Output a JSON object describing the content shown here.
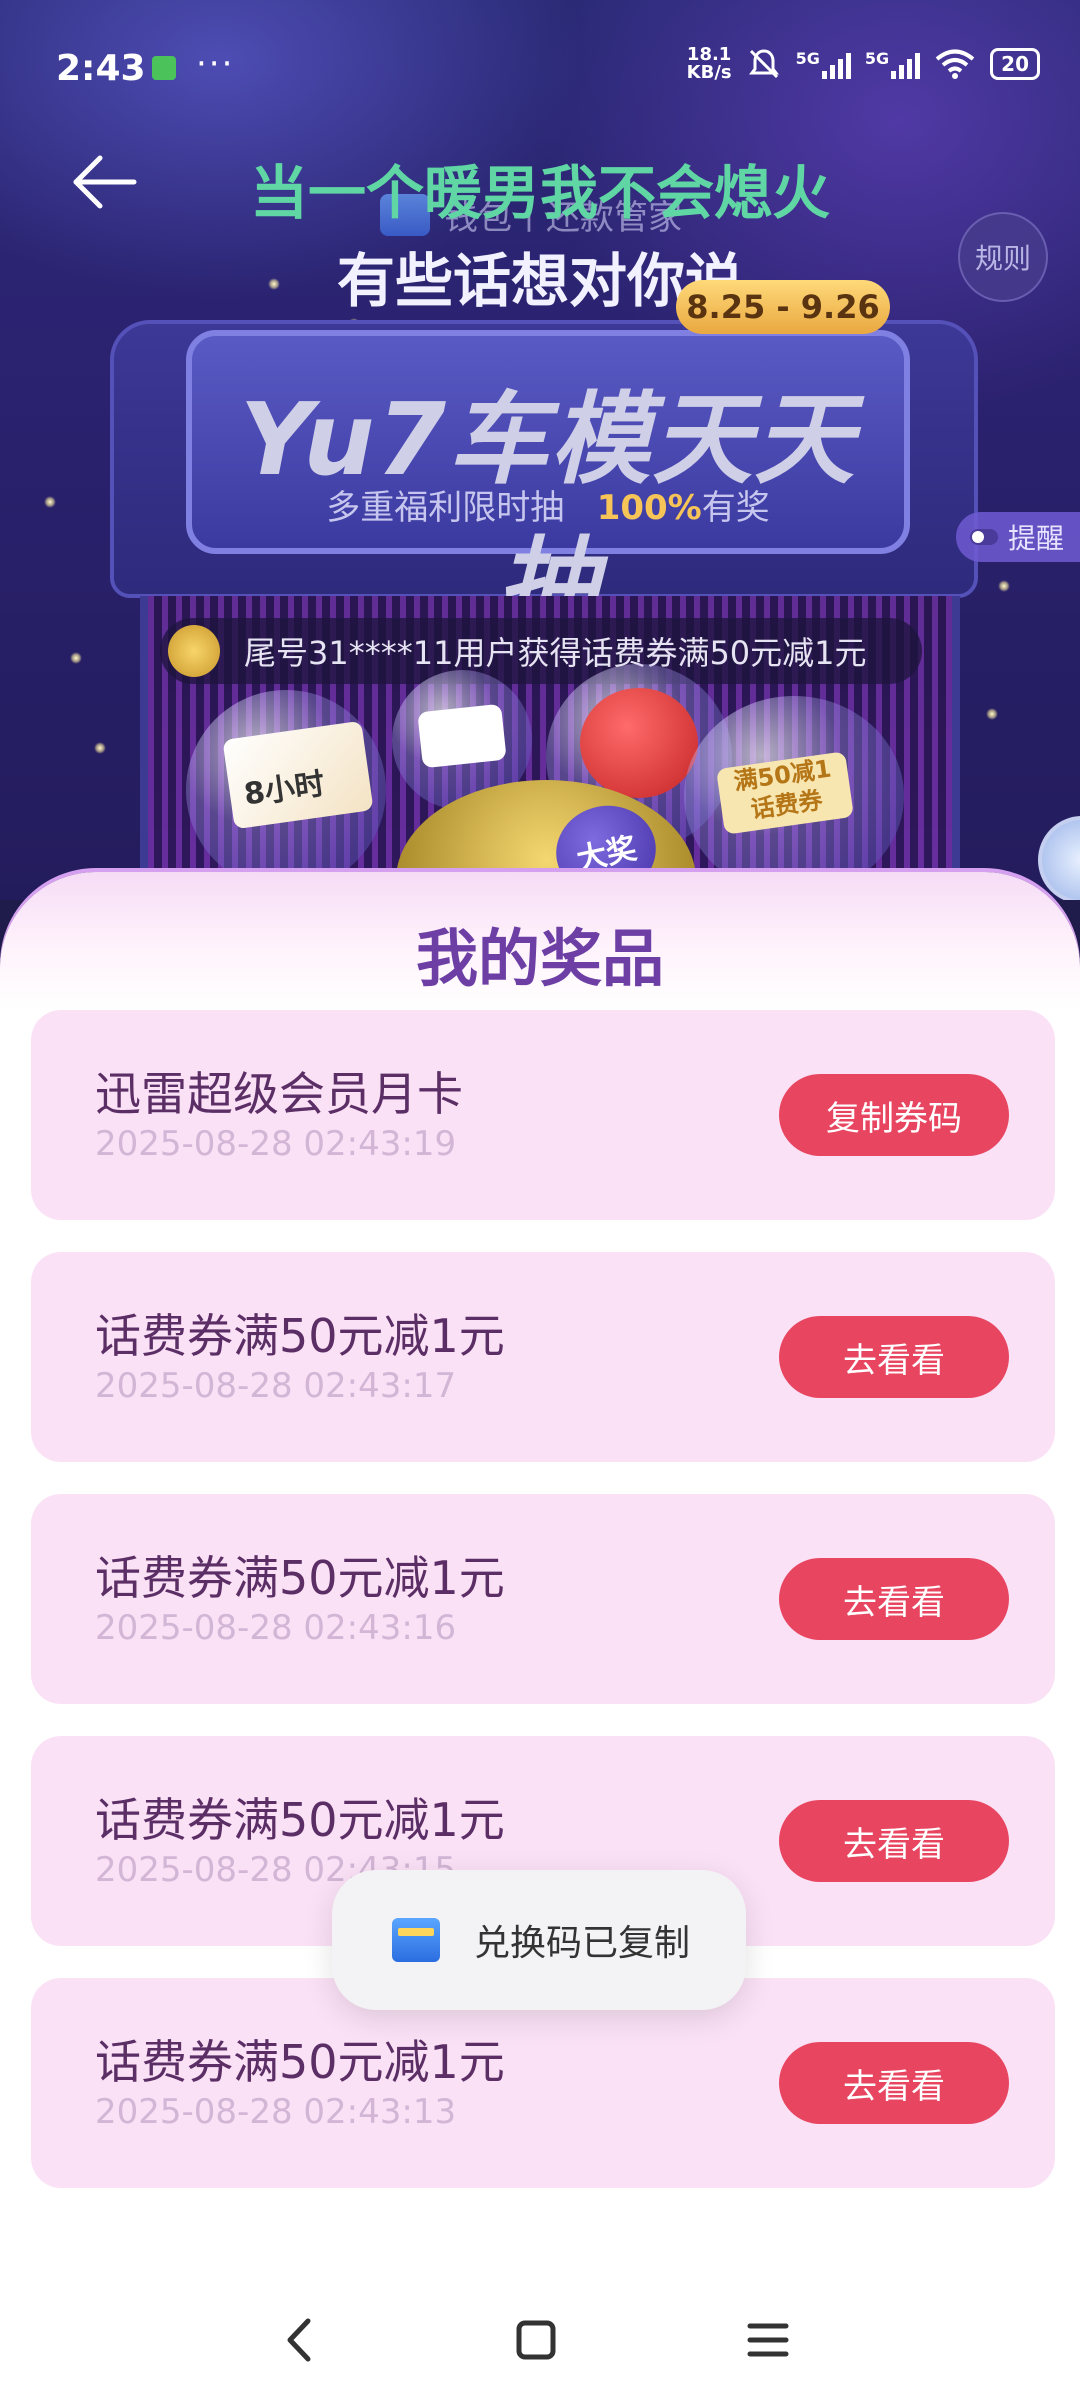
{
  "status_bar": {
    "time": "2:43",
    "more_dots": "···",
    "net_speed_value": "18.1",
    "net_speed_unit": "KB/s",
    "signal1_label": "5G",
    "signal2_label": "5G",
    "battery": "20"
  },
  "header": {
    "line1": "当一个暖男我不会熄火",
    "line2": "有些话想对你说",
    "wallet_caption": "钱包丨还款管家",
    "rules_label": "规则",
    "remind_label": "提醒"
  },
  "campaign": {
    "date_range": "8.25 - 9.26",
    "title": "Yu7车模天天抽",
    "subtitle_plain": "多重福利限时抽",
    "subtitle_highlight": "100%",
    "subtitle_suffix": "有奖",
    "ticker_text": "尾号31****11用户获得话费券满50元减1元",
    "ball_card_time": "8小时",
    "ball_coupon_line1": "满50减1",
    "ball_coupon_line2": "话费券",
    "big_prize_label": "大奖"
  },
  "sheet": {
    "title": "我的奖品",
    "prizes": [
      {
        "name": "迅雷超级会员月卡",
        "time": "2025-08-28 02:43:19",
        "button": "复制券码"
      },
      {
        "name": "话费券满50元减1元",
        "time": "2025-08-28 02:43:17",
        "button": "去看看"
      },
      {
        "name": "话费券满50元减1元",
        "time": "2025-08-28 02:43:16",
        "button": "去看看"
      },
      {
        "name": "话费券满50元减1元",
        "time": "2025-08-28 02:43:15",
        "button": "去看看"
      },
      {
        "name": "话费券满50元减1元",
        "time": "2025-08-28 02:43:13",
        "button": "去看看"
      }
    ]
  },
  "toast": {
    "text": "兑换码已复制",
    "icon": "wallet-icon"
  },
  "navigation": {
    "back_icon": "chevron-left-icon",
    "home_icon": "square-home-icon",
    "menu_icon": "hamburger-menu-icon"
  },
  "colors": {
    "accent_button": "#e84561",
    "card_bg": "#fbe1f6",
    "sheet_title": "#6d3fa5",
    "header_green": "#5fd6a4"
  }
}
